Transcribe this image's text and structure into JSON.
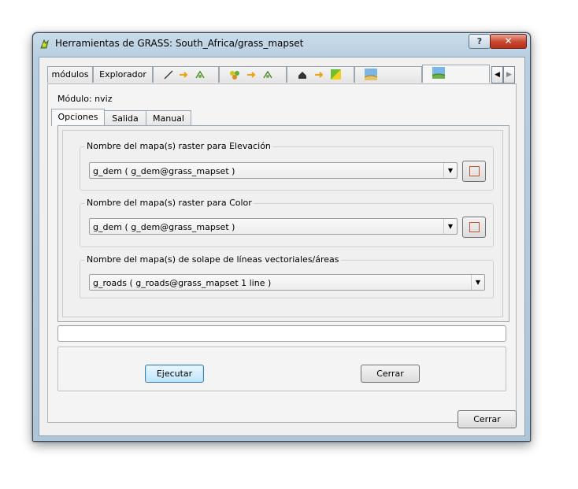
{
  "window": {
    "title": "Herramientas de GRASS: South_Africa/grass_mapset",
    "help_label": "?",
    "close_label": "✕"
  },
  "top_tabs": {
    "modules_label": "módulos",
    "explorer_label": "Explorador",
    "scroll_left": "◀",
    "scroll_right": "▶"
  },
  "module": {
    "label": "Módulo: nviz"
  },
  "sub_tabs": {
    "options": "Opciones",
    "output": "Salida",
    "manual": "Manual"
  },
  "fields": {
    "elevation": {
      "label": "Nombre del mapa(s) raster para Elevación",
      "value": "g_dem ( g_dem@grass_mapset )"
    },
    "color": {
      "label": "Nombre del mapa(s) raster para Color",
      "value": "g_dem ( g_dem@grass_mapset )"
    },
    "vector": {
      "label": "Nombre del mapa(s) de solape de líneas vectoriales/áreas",
      "value": "g_roads ( g_roads@grass_mapset 1 line )"
    }
  },
  "buttons": {
    "run": "Ejecutar",
    "close_module": "Cerrar",
    "close_dialog": "Cerrar"
  },
  "icons": {
    "toolbar": [
      "line-icon",
      "arrow-icon",
      "vector-icon",
      "points-icon",
      "arrow-icon",
      "vector-icon",
      "house-icon",
      "arrow-icon",
      "raster-icon",
      "landscape-icon",
      "landscape-icon"
    ],
    "combo_arrow": "▼"
  },
  "colors": {
    "accent_arrow": "#e8a317",
    "region_square": "#c5502d"
  }
}
